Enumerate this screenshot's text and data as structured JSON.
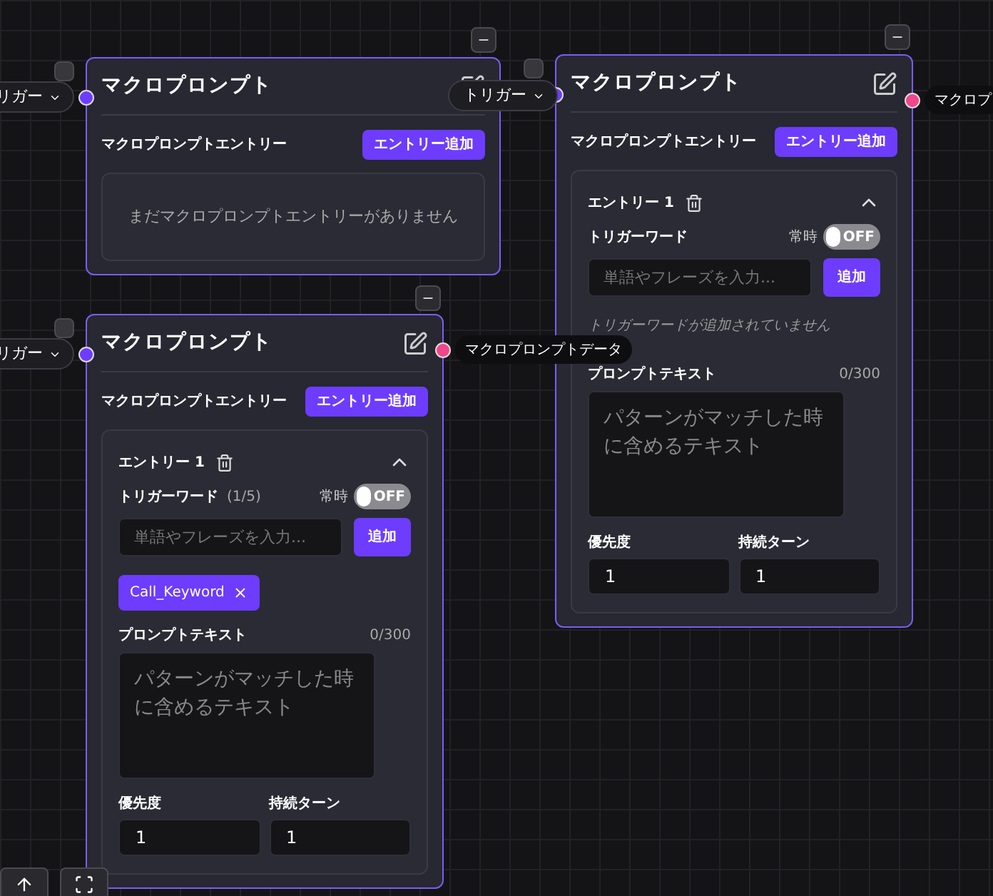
{
  "nodes": [
    {
      "title": "マクロプロンプト",
      "input_pill": {
        "label": "リガー"
      },
      "section_label": "マクロプロンプトエントリー",
      "add_entry_button": "エントリー追加",
      "empty_message": "まだマクロプロンプトエントリーがありません"
    },
    {
      "title": "マクロプロンプト",
      "input_pill": {
        "label": "トリガー"
      },
      "output": {
        "label": "マクロプ"
      },
      "section_label": "マクロプロンプトエントリー",
      "add_entry_button": "エントリー追加",
      "entries": [
        {
          "title": "エントリー 1",
          "expanded": true,
          "trigger_label": "トリガーワード",
          "always_label": "常時",
          "always_on": false,
          "toggle_text": "OFF",
          "input_placeholder": "単語やフレーズを入力...",
          "add_button": "追加",
          "no_tags_message": "トリガーワードが追加されていません",
          "prompt_label": "プロンプトテキスト",
          "prompt_count": "0/300",
          "prompt_placeholder": "パターンがマッチした時に含めるテキスト",
          "priority_label": "優先度",
          "priority_value": "1",
          "duration_label": "持続ターン",
          "duration_value": "1"
        }
      ]
    },
    {
      "title": "マクロプロンプト",
      "input_pill": {
        "label": "リガー"
      },
      "output": {
        "label": "マクロプロンプトデータ"
      },
      "section_label": "マクロプロンプトエントリー",
      "add_entry_button": "エントリー追加",
      "entries": [
        {
          "title": "エントリー 1",
          "expanded": true,
          "trigger_label": "トリガーワード",
          "trigger_count": "(1/5)",
          "always_label": "常時",
          "always_on": false,
          "toggle_text": "OFF",
          "input_placeholder": "単語やフレーズを入力...",
          "add_button": "追加",
          "tags": [
            {
              "label": "Call_Keyword"
            }
          ],
          "prompt_label": "プロンプトテキスト",
          "prompt_count": "0/300",
          "prompt_placeholder": "パターンがマッチした時に含めるテキスト",
          "priority_label": "優先度",
          "priority_value": "1",
          "duration_label": "持続ターン",
          "duration_value": "1"
        }
      ]
    }
  ]
}
